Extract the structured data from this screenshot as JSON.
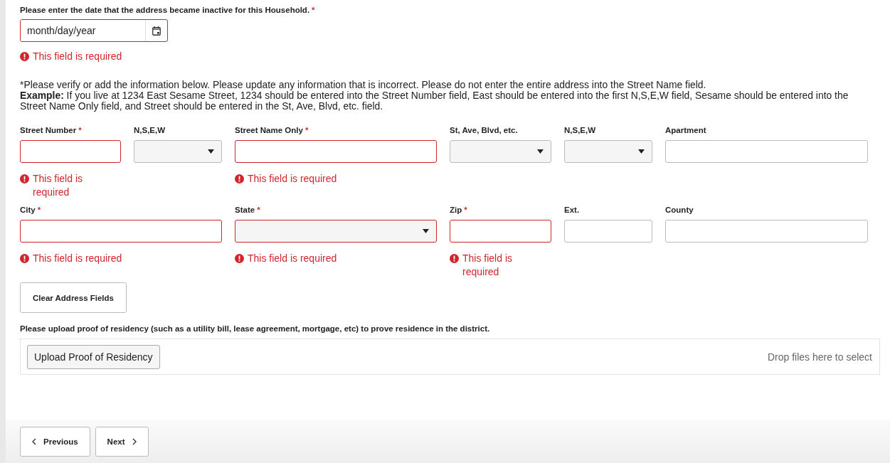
{
  "date_question": {
    "label": "Please enter the date that the address became inactive for this Household.",
    "required_mark": "*",
    "placeholder": "month/day/year",
    "error": "This field is required"
  },
  "instructions": [
    "*Please verify or add the information below. Please update any information that is incorrect. Please do not enter the entire address into the Street Name field.",
    "**Example:** If you live at 1234 East Sesame Street, 1234 should be entered into the Street Number field, East should be entered into the first N,S,E,W field, Sesame should be entered into the Street Name Only field, and Street should be entered in the St, Ave, Blvd, etc. field."
  ],
  "address_rows": [
    {
      "fields": [
        {
          "label": "Street Number",
          "required_mark": "*",
          "kind": "text",
          "error": "This field is required"
        },
        {
          "label": "N,S,E,W",
          "kind": "select"
        },
        {
          "label": "Street Name Only",
          "required_mark": "*",
          "kind": "text",
          "error": "This field is required"
        },
        {
          "label": "St, Ave, Blvd, etc.",
          "kind": "select"
        },
        {
          "label": "N,S,E,W",
          "kind": "select"
        },
        {
          "label": "Apartment",
          "kind": "text"
        }
      ]
    },
    {
      "fields": [
        {
          "label": "City",
          "required_mark": "*",
          "kind": "text",
          "error": "This field is required"
        },
        {
          "label": "State",
          "required_mark": "*",
          "kind": "select",
          "error": "This field is required"
        },
        {
          "label": "Zip",
          "required_mark": "*",
          "kind": "text",
          "error": "This field is required"
        },
        {
          "label": "Ext.",
          "kind": "text"
        },
        {
          "label": "County",
          "kind": "text"
        }
      ]
    }
  ],
  "clear_button": "Clear Address Fields",
  "upload": {
    "label": "Please upload proof of residency (such as a utility bill, lease agreement, mortgage, etc) to prove residence in the district.",
    "button": "Upload Proof of Residency",
    "drop_hint": "Drop files here to select"
  },
  "nav_buttons": [
    {
      "kind": "previous",
      "label": "Previous"
    },
    {
      "kind": "next",
      "label": "Next"
    }
  ]
}
